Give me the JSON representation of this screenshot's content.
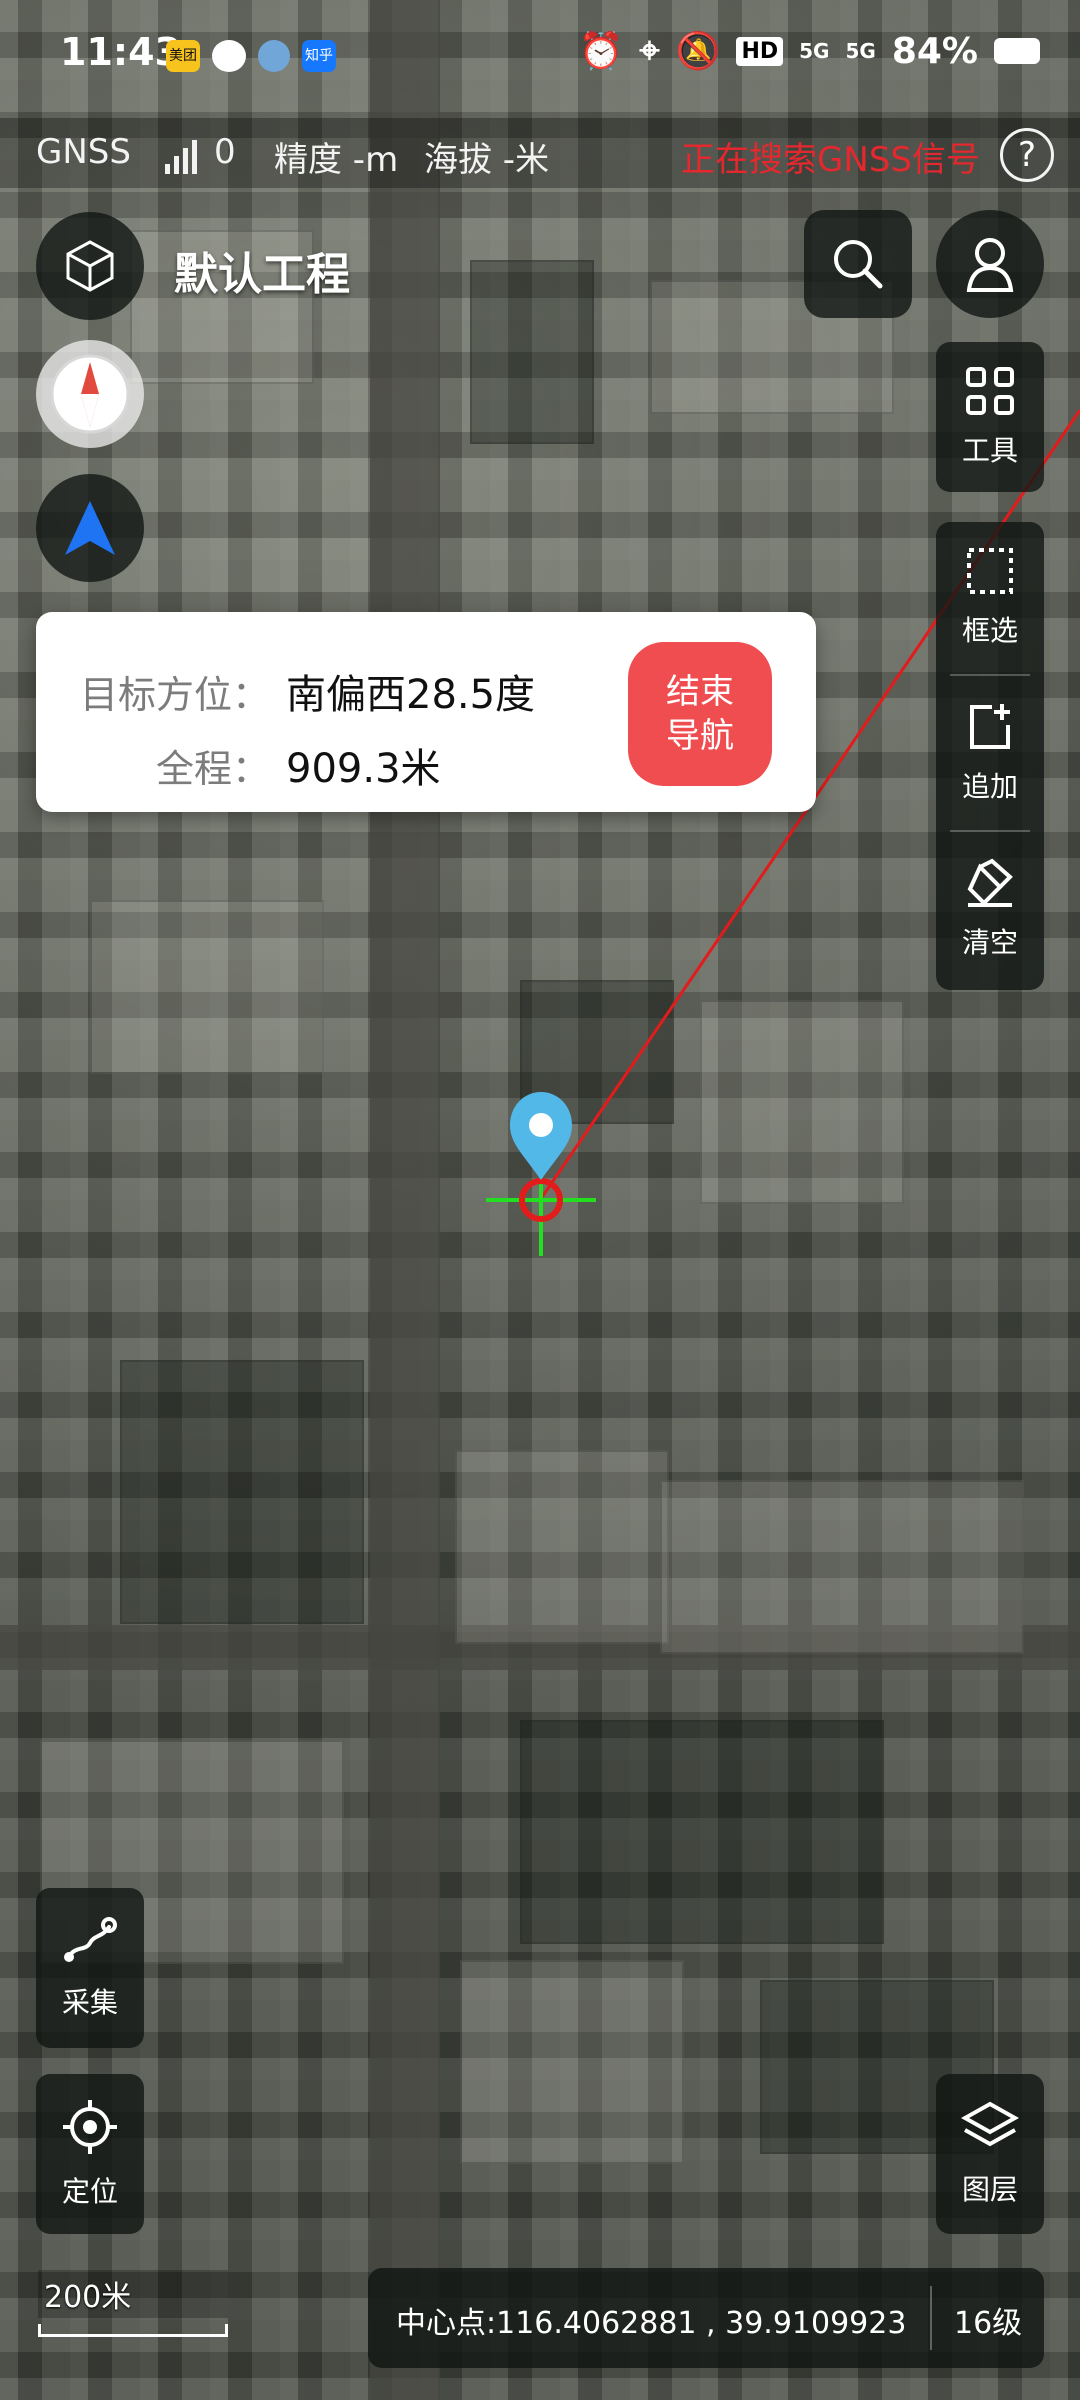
{
  "status_bar": {
    "time": "11:43",
    "apps": [
      "美团",
      "知乎"
    ],
    "network_1": "HD",
    "network_2": "5G",
    "network_3": "5G",
    "battery": "84%"
  },
  "gnss_bar": {
    "label": "GNSS",
    "satellites": "0",
    "accuracy": "精度 -m",
    "altitude": "海拔 -米",
    "status": "正在搜索GNSS信号",
    "help": "?"
  },
  "project": {
    "title": "默认工程"
  },
  "right_toolbar": {
    "tools_label": "工具",
    "box_select_label": "框选",
    "add_label": "追加",
    "clear_label": "清空",
    "layers_label": "图层"
  },
  "navigation": {
    "bearing_label": "目标方位：",
    "bearing_value": "南偏西28.5度",
    "distance_label": "全程：",
    "distance_value": "909.3米",
    "end_button_line1": "结束",
    "end_button_line2": "导航"
  },
  "left_toolbar": {
    "collect_label": "采集",
    "locate_label": "定位"
  },
  "map": {
    "scale_label": "200米",
    "center_label": "中心点:116.4062881 , 39.9109923",
    "zoom_level": "16级"
  },
  "colors": {
    "accent_red": "#f04d50",
    "warning_red": "#e5282e",
    "crosshair_green": "#22e01f",
    "marker_blue": "#51b8e8"
  }
}
